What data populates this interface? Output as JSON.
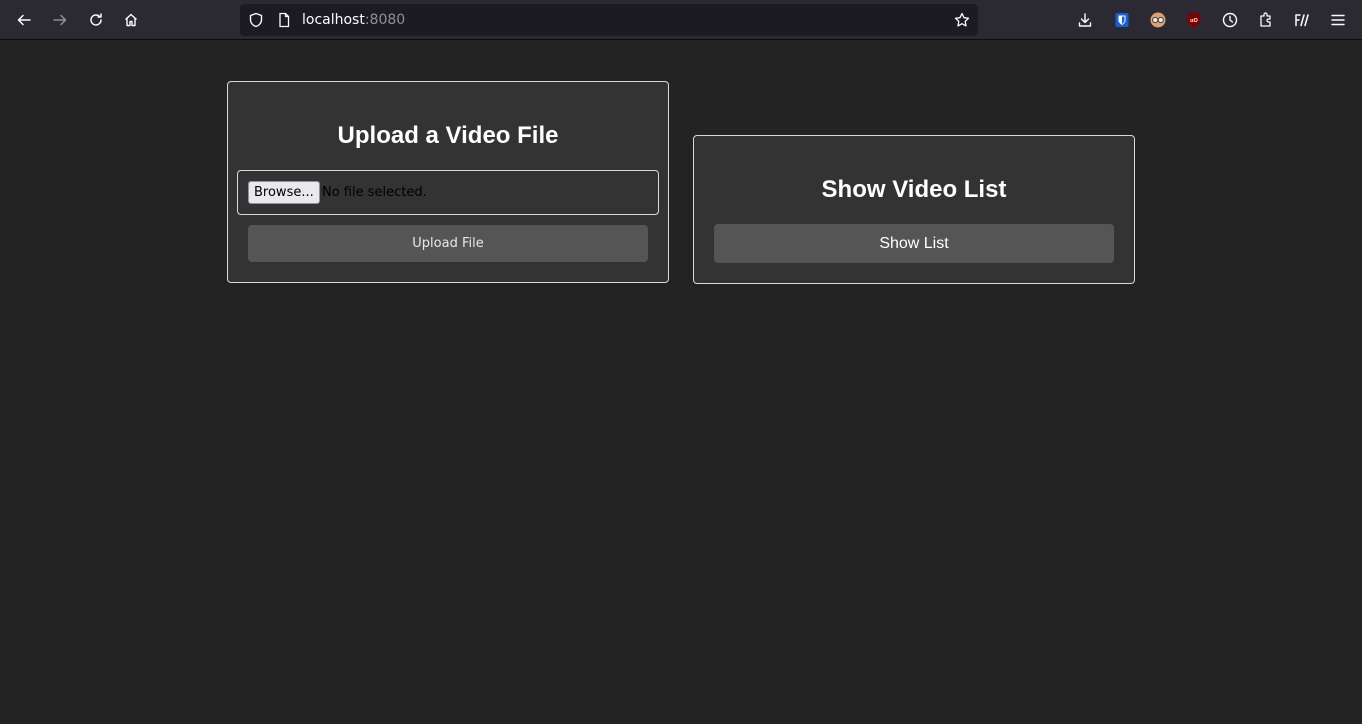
{
  "browser": {
    "url_host": "localhost",
    "url_port": ":8080",
    "nav_icons": [
      "back-icon",
      "forward-icon",
      "reload-icon",
      "home-icon"
    ],
    "toolbar_icons": [
      "downloads-icon",
      "bitwarden-icon",
      "extension-glasses-icon",
      "ublock-icon",
      "history-icon",
      "extensions-icon",
      "library-icon",
      "menu-icon"
    ]
  },
  "upload_card": {
    "title": "Upload a Video File",
    "browse_label": "Browse...",
    "file_status": "No file selected.",
    "upload_label": "Upload File"
  },
  "list_card": {
    "title": "Show Video List",
    "show_label": "Show List"
  },
  "colors": {
    "page_bg": "#232323",
    "card_bg": "#333333",
    "button_bg": "#555555",
    "toolbar_bg": "#2b2a33"
  }
}
